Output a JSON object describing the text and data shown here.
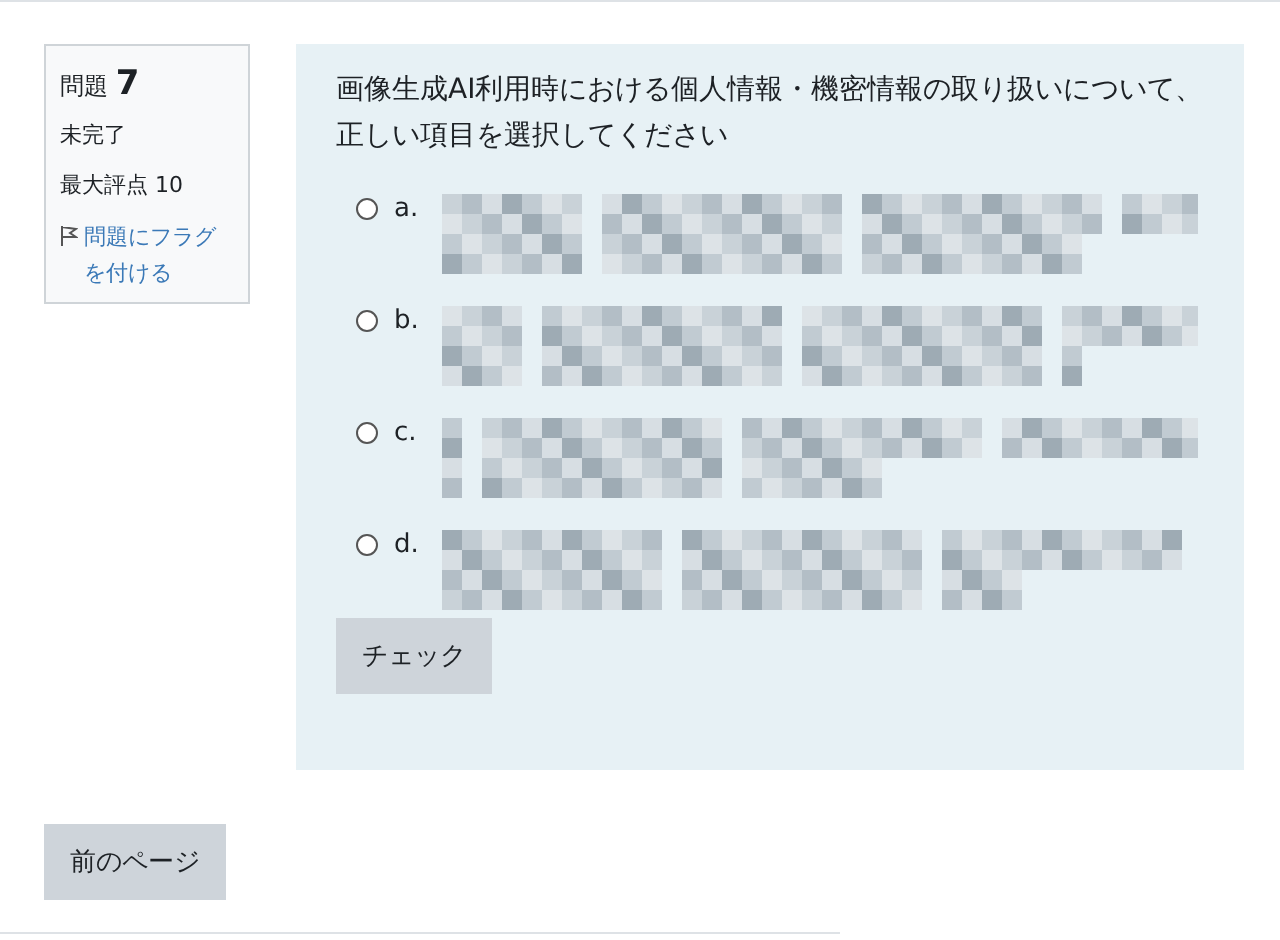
{
  "info": {
    "question_label": "問題",
    "question_number": "7",
    "status": "未完了",
    "max_grade": "最大評点 10",
    "flag_link": "問題にフラグを付ける"
  },
  "question": {
    "text": "画像生成AI利用時における個人情報・機密情報の取り扱いについて、正しい項目を選択してください",
    "options": [
      {
        "label": "a.",
        "selected": false
      },
      {
        "label": "b.",
        "selected": false
      },
      {
        "label": "c.",
        "selected": false
      },
      {
        "label": "d.",
        "selected": false
      }
    ],
    "check_button": "チェック"
  },
  "nav": {
    "previous_button": "前のページ"
  }
}
